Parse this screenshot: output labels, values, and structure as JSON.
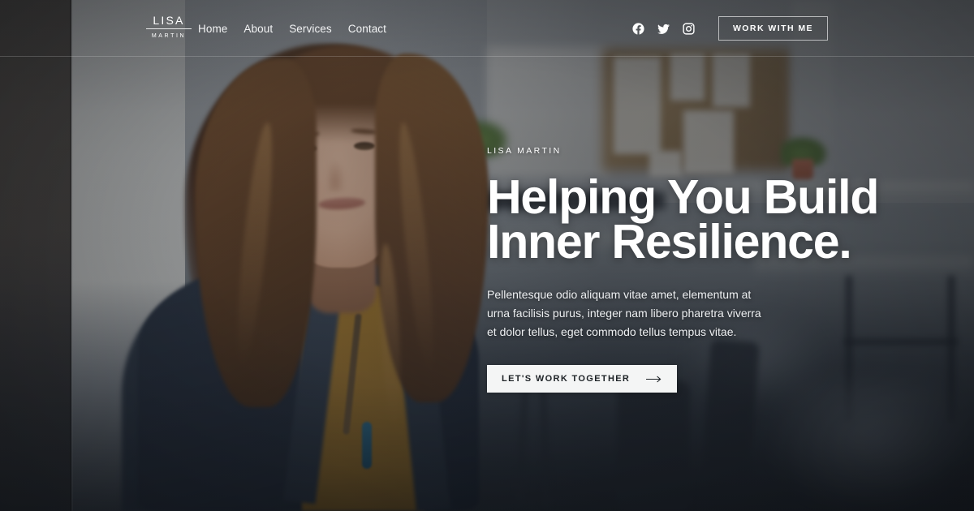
{
  "brand": {
    "name_top": "LISA",
    "name_bottom": "MARTIN"
  },
  "nav": {
    "items": [
      {
        "label": "Home"
      },
      {
        "label": "About"
      },
      {
        "label": "Services"
      },
      {
        "label": "Contact"
      }
    ]
  },
  "social": {
    "items": [
      {
        "icon": "facebook-icon",
        "label": "Facebook"
      },
      {
        "icon": "twitter-icon",
        "label": "Twitter"
      },
      {
        "icon": "instagram-icon",
        "label": "Instagram"
      }
    ]
  },
  "header": {
    "cta_label": "WORK WITH ME"
  },
  "hero": {
    "eyebrow": "LISA MARTIN",
    "title_line1": "Helping You Build",
    "title_line2": "Inner Resilience.",
    "description": "Pellentesque odio aliquam vitae amet, elementum at urna facilisis purus, integer nam libero pharetra viverra et dolor tellus, eget commodo tellus tempus vitae.",
    "cta_label": "LET'S WORK TOGETHER",
    "cta_icon": "arrow-right-icon"
  },
  "colors": {
    "text_light": "#ffffff",
    "cta_background": "#f4f5f5",
    "cta_text": "#1d2226",
    "header_divider": "rgba(255,255,255,0.18)"
  }
}
